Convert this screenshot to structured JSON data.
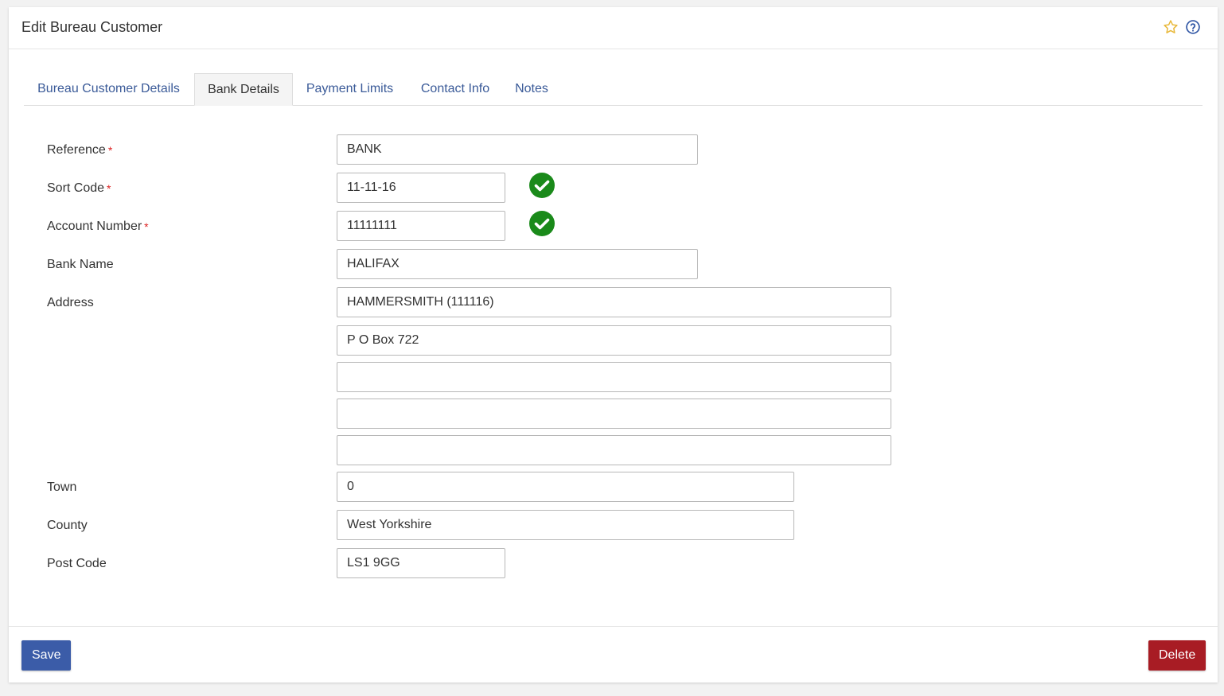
{
  "header": {
    "title": "Edit Bureau Customer",
    "star_icon": "star-outline-icon",
    "help_icon": "question-circle-icon",
    "star_color": "#e8b83a",
    "help_color": "#2f55a4"
  },
  "tabs": [
    {
      "label": "Bureau Customer Details",
      "active": false
    },
    {
      "label": "Bank Details",
      "active": true
    },
    {
      "label": "Payment Limits",
      "active": false
    },
    {
      "label": "Contact Info",
      "active": false
    },
    {
      "label": "Notes",
      "active": false
    }
  ],
  "form": {
    "reference": {
      "label": "Reference",
      "required": "*",
      "value": "BANK"
    },
    "sort_code": {
      "label": "Sort Code",
      "required": "*",
      "value": "11-11-16",
      "valid_icon": "check-circle-icon"
    },
    "account_number": {
      "label": "Account Number",
      "required": "*",
      "value": "11111111",
      "valid_icon": "check-circle-icon"
    },
    "bank_name": {
      "label": "Bank Name",
      "value": "HALIFAX"
    },
    "address": {
      "label": "Address",
      "lines": [
        "HAMMERSMITH (111116)",
        "P O Box 722",
        "",
        "",
        ""
      ]
    },
    "town": {
      "label": "Town",
      "value": "0"
    },
    "county": {
      "label": "County",
      "value": "West Yorkshire"
    },
    "post_code": {
      "label": "Post Code",
      "value": "LS1 9GG"
    }
  },
  "footer": {
    "save_label": "Save",
    "delete_label": "Delete",
    "save_color": "#3b5ca8",
    "delete_color": "#a81c24"
  },
  "colors": {
    "valid_green": "#1a8a1a",
    "required_red": "#d22222",
    "tab_link": "#3a5a98"
  }
}
